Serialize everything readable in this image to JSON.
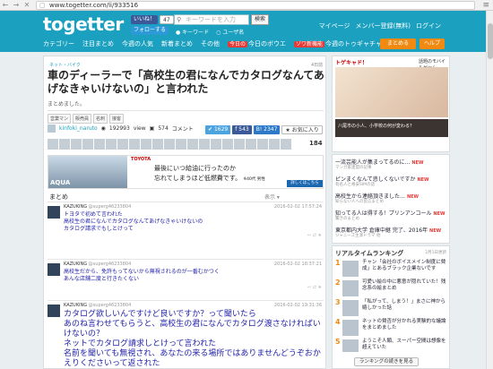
{
  "browser": {
    "url": "www.togetter.com/li/933516"
  },
  "header": {
    "logo": "togetter",
    "like_label": "いいね！",
    "like_count": "47",
    "follow_label": "フォローする",
    "search_placeholder": "キーワードを入力",
    "search_button": "検索",
    "radio_keyword": "キーワード",
    "radio_user": "ユーザ名",
    "links": [
      "マイページ",
      "メンバー登録(無料)",
      "ログイン"
    ],
    "nav": [
      "カテゴリー",
      "注目まとめ",
      "今週の人気",
      "新着まとめ",
      "その他",
      "今日のボウエ",
      "今週のトゥギャチャレンジ！"
    ],
    "nav_badges": [
      "今日の",
      "ゾワ新機能"
    ],
    "make_button": "まとめる",
    "help_button": "ヘルプ"
  },
  "article": {
    "breadcrumb": "ネット・バイク",
    "page_views": "4日前",
    "title": "車のディーラーで「高校生の君になんでカタログなんてあげなきゃいけないの」と言われた",
    "description": "まとめました。",
    "tags": [
      "営業マン",
      "販売員",
      "名刺",
      "接客"
    ],
    "author": "kinfoki_naruto",
    "views": "192993",
    "views_label": "view",
    "comments": "574",
    "comments_label": "コメント",
    "tweet_count": "1629",
    "fb_count": "543",
    "hb_count": "2347",
    "fav_label": "お気に入り",
    "fav_count": "184",
    "section_label": "まとめ",
    "section_ctrl": "表示 ▾"
  },
  "ad": {
    "brand": "TOYOTA",
    "car_name": "AQUA",
    "line1": "最後にいつ給油に行ったのか",
    "line2": "忘れてしまうほど低燃費です。",
    "line2_small": "※40代 男性",
    "more": "詳しくはこちら"
  },
  "tweets": [
    {
      "user": "KAZUKING",
      "uid": "@superg46233804",
      "time": "2016-02-02 17:57:24",
      "lines": [
        "トヨタで初めて言われた",
        "高校生の君になんでカタログなんてあげなきゃいけないの",
        "カタログ請求でもしとけって"
      ]
    },
    {
      "user": "KAZUKING",
      "uid": "@superg46233804",
      "time": "2016-02-02 18:37:21",
      "lines": [
        "高校生だから、免許もってないから無視されるのが一番むかつく",
        "あんな店舗二度と行きたくない"
      ]
    },
    {
      "user": "KAZUKING",
      "uid": "@superg46233804",
      "time": "2016-02-02 19:31:36",
      "lines": [
        "カタログ欲しいんですけど良いですか？って聞いたら",
        "あのね言わせてもらうと、高校生の君になんでカタログ渡さなければいけないの？",
        "ネットでカタログ請求しとけって言われた",
        "名前を聞いても無視され、あなたの来る場所ではありませんどうぞおかえりくださいって返された"
      ]
    }
  ],
  "sidebar": {
    "ad_header": "トゲキャド！",
    "ad_sub": "話題のモバイルゲーム",
    "ad_caption": "八尾市の小人、小学校の何が変わる？",
    "list": [
      {
        "text": "一流芸能人が集まってるのに…",
        "sub": "マンガ家連盟の記事"
      },
      {
        "text": "ピンまくなんて悲しくないですか",
        "sub": "有名人と格安SIMの話"
      },
      {
        "text": "高校生から連絡頂きました…",
        "sub": "知らない人への反応まとめ"
      },
      {
        "text": "知ってる人は得する！プリンアンコール",
        "sub": "驚きのまとめ"
      },
      {
        "text": "東京都内大学 倉庫中継 完了、2016年",
        "sub": "ジャニーズ主演ドラマ 他"
      }
    ],
    "ranking_title": "リアルタイムランキング",
    "ranking_updated": "2月1日更新",
    "ranking": [
      {
        "num": "1",
        "text": "チャン「会社のボイスメイン制度に賛成」とあるブラック企業ないです"
      },
      {
        "num": "2",
        "text": "可愛い絵の中に悪意が隠れていた！残念系の絵まとめ"
      },
      {
        "num": "3",
        "text": "「私がって、しまう！」まさに神から嬉しかった話"
      },
      {
        "num": "4",
        "text": "ネットの賛否が分かれる実験的な議論をまとめました"
      },
      {
        "num": "5",
        "text": "ようこそ人類、スーパー空間は想像を超えていた"
      }
    ],
    "ranking_more": "ランキングの続きを見る"
  }
}
